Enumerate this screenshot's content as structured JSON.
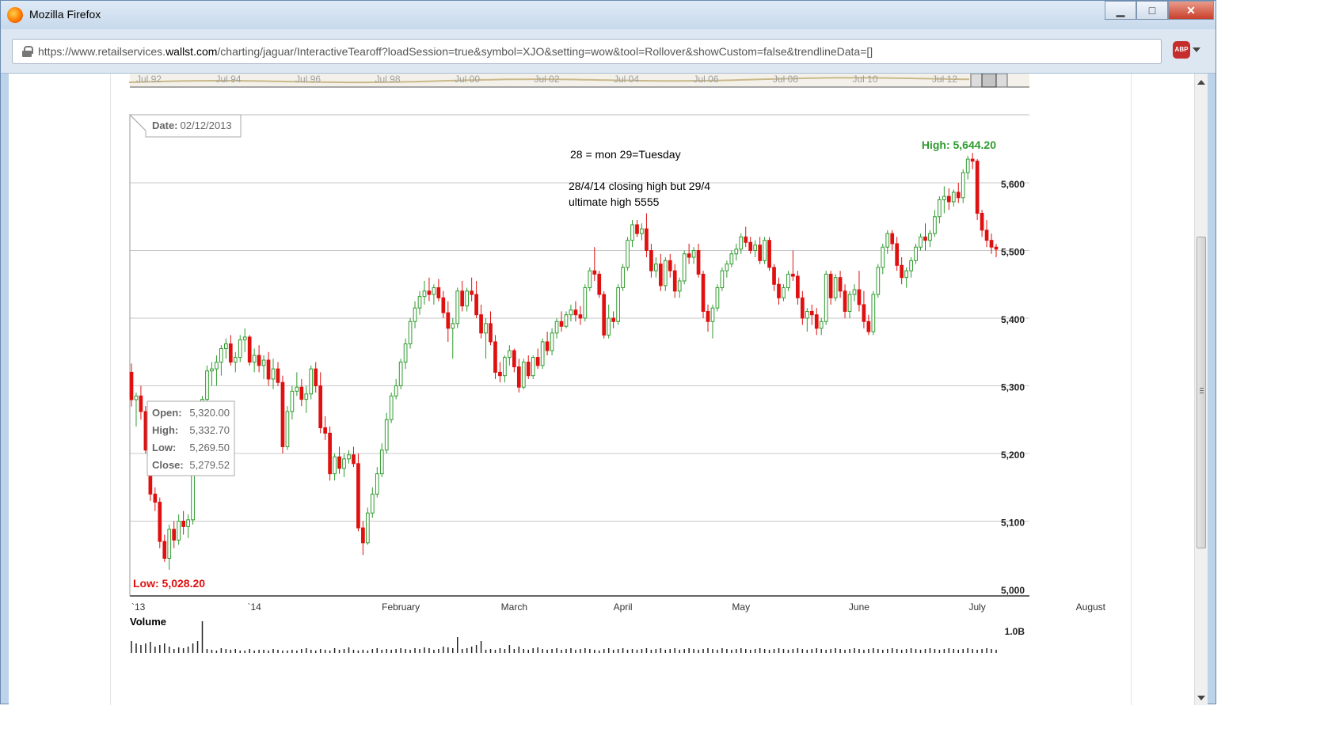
{
  "window": {
    "title": "Mozilla Firefox",
    "url_prefix": "https://www.retailservices.",
    "url_domain": "wallst.com",
    "url_suffix": "/charting/jaguar/InteractiveTearoff?loadSession=true&symbol=XJO&setting=wow&tool=Rollover&showCustom=false&trendlineData=[]",
    "minimize_label": "▁",
    "maximize_label": "□",
    "close_label": "✕",
    "adblock_label": "ABP"
  },
  "navigator": {
    "labels": [
      "Jul 92",
      "Jul 94",
      "Jul 96",
      "Jul 98",
      "Jul 00",
      "Jul 02",
      "Jul 04",
      "Jul 06",
      "Jul 08",
      "Jul 10",
      "Jul 12"
    ]
  },
  "chart": {
    "date_label": "Date:",
    "date_value": "02/12/2013",
    "annotation_line1": "28 = mon 29=Tuesday",
    "annotation_line2": "28/4/14 closing high but 29/4",
    "annotation_line3": "ultimate high 5555",
    "high_label": "High: 5,644.20",
    "low_label": "Low: 5,028.20",
    "tooltip": {
      "open_label": "Open:",
      "open_value": "5,320.00",
      "high_label": "High:",
      "high_value": "5,332.70",
      "low_label": "Low:",
      "low_value": "5,269.50",
      "close_label": "Close:",
      "close_value": "5,279.52"
    },
    "volume_label": "Volume",
    "volume_tick": "1.0B",
    "colors": {
      "up": "#2e9b2e",
      "down": "#e01010",
      "high": "#2e9b2e",
      "low": "#e01010",
      "grid": "#c8c8c8"
    }
  },
  "chart_data": {
    "type": "candlestick",
    "title": "",
    "ylim": [
      5000,
      5680
    ],
    "y_ticks": [
      "5,000",
      "5,100",
      "5,200",
      "5,300",
      "5,400",
      "5,500",
      "5,600"
    ],
    "y_tick_values": [
      5000,
      5100,
      5200,
      5300,
      5400,
      5500,
      5600
    ],
    "x_labels": [
      "`13",
      "`14",
      "February",
      "March",
      "April",
      "May",
      "June",
      "July",
      "August"
    ],
    "x_label_index": [
      0,
      26,
      57,
      81,
      104,
      129,
      154,
      179,
      203
    ],
    "candles": [
      [
        5320,
        5332.7,
        5269.5,
        5279.5
      ],
      [
        5279.5,
        5290,
        5240,
        5285
      ],
      [
        5285,
        5300,
        5250,
        5262
      ],
      [
        5262,
        5270,
        5200,
        5205
      ],
      [
        5205,
        5215,
        5130,
        5140
      ],
      [
        5140,
        5150,
        5115,
        5128
      ],
      [
        5128,
        5135,
        5060,
        5070
      ],
      [
        5070,
        5080,
        5040,
        5045
      ],
      [
        5045,
        5095,
        5028.2,
        5088
      ],
      [
        5088,
        5100,
        5060,
        5072
      ],
      [
        5072,
        5110,
        5065,
        5100
      ],
      [
        5100,
        5115,
        5080,
        5092
      ],
      [
        5092,
        5110,
        5075,
        5102
      ],
      [
        5102,
        5210,
        5095,
        5200
      ],
      [
        5200,
        5270,
        5190,
        5262
      ],
      [
        5262,
        5285,
        5250,
        5280
      ],
      [
        5280,
        5330,
        5275,
        5322
      ],
      [
        5322,
        5335,
        5300,
        5325
      ],
      [
        5325,
        5345,
        5300,
        5335
      ],
      [
        5335,
        5360,
        5315,
        5355
      ],
      [
        5355,
        5370,
        5340,
        5362
      ],
      [
        5362,
        5375,
        5330,
        5335
      ],
      [
        5335,
        5350,
        5320,
        5342
      ],
      [
        5342,
        5375,
        5335,
        5368
      ],
      [
        5368,
        5385,
        5350,
        5372
      ],
      [
        5372,
        5375,
        5330,
        5335
      ],
      [
        5335,
        5355,
        5320,
        5345
      ],
      [
        5345,
        5360,
        5320,
        5330
      ],
      [
        5330,
        5345,
        5310,
        5338
      ],
      [
        5338,
        5350,
        5300,
        5310
      ],
      [
        5310,
        5340,
        5295,
        5325
      ],
      [
        5325,
        5335,
        5300,
        5305
      ],
      [
        5305,
        5315,
        5200,
        5210
      ],
      [
        5210,
        5270,
        5205,
        5262
      ],
      [
        5262,
        5300,
        5250,
        5292
      ],
      [
        5292,
        5320,
        5285,
        5298
      ],
      [
        5298,
        5310,
        5270,
        5280
      ],
      [
        5280,
        5300,
        5260,
        5288
      ],
      [
        5288,
        5330,
        5280,
        5325
      ],
      [
        5325,
        5335,
        5290,
        5300
      ],
      [
        5300,
        5320,
        5230,
        5238
      ],
      [
        5238,
        5255,
        5220,
        5230
      ],
      [
        5230,
        5240,
        5160,
        5170
      ],
      [
        5170,
        5200,
        5160,
        5195
      ],
      [
        5195,
        5210,
        5170,
        5178
      ],
      [
        5178,
        5200,
        5165,
        5192
      ],
      [
        5192,
        5205,
        5185,
        5198
      ],
      [
        5198,
        5210,
        5180,
        5185
      ],
      [
        5185,
        5200,
        5085,
        5090
      ],
      [
        5090,
        5100,
        5050,
        5068
      ],
      [
        5068,
        5120,
        5065,
        5112
      ],
      [
        5112,
        5150,
        5105,
        5140
      ],
      [
        5140,
        5180,
        5135,
        5170
      ],
      [
        5170,
        5215,
        5165,
        5205
      ],
      [
        5205,
        5260,
        5200,
        5250
      ],
      [
        5250,
        5290,
        5245,
        5285
      ],
      [
        5285,
        5310,
        5280,
        5300
      ],
      [
        5300,
        5340,
        5295,
        5335
      ],
      [
        5335,
        5370,
        5325,
        5362
      ],
      [
        5362,
        5400,
        5355,
        5395
      ],
      [
        5395,
        5425,
        5385,
        5415
      ],
      [
        5415,
        5440,
        5405,
        5432
      ],
      [
        5432,
        5455,
        5420,
        5440
      ],
      [
        5440,
        5460,
        5425,
        5435
      ],
      [
        5435,
        5450,
        5420,
        5445
      ],
      [
        5445,
        5458,
        5425,
        5430
      ],
      [
        5430,
        5440,
        5400,
        5408
      ],
      [
        5408,
        5425,
        5365,
        5385
      ],
      [
        5385,
        5400,
        5340,
        5392
      ],
      [
        5392,
        5445,
        5385,
        5440
      ],
      [
        5440,
        5455,
        5410,
        5418
      ],
      [
        5418,
        5445,
        5410,
        5440
      ],
      [
        5440,
        5460,
        5425,
        5435
      ],
      [
        5435,
        5455,
        5400,
        5405
      ],
      [
        5405,
        5420,
        5370,
        5378
      ],
      [
        5378,
        5400,
        5340,
        5392
      ],
      [
        5392,
        5410,
        5360,
        5365
      ],
      [
        5365,
        5375,
        5310,
        5320
      ],
      [
        5320,
        5335,
        5305,
        5315
      ],
      [
        5315,
        5345,
        5305,
        5342
      ],
      [
        5342,
        5360,
        5330,
        5352
      ],
      [
        5352,
        5355,
        5320,
        5328
      ],
      [
        5328,
        5340,
        5290,
        5298
      ],
      [
        5298,
        5340,
        5295,
        5335
      ],
      [
        5335,
        5345,
        5310,
        5315
      ],
      [
        5315,
        5345,
        5310,
        5342
      ],
      [
        5342,
        5355,
        5325,
        5330
      ],
      [
        5330,
        5370,
        5325,
        5365
      ],
      [
        5365,
        5380,
        5345,
        5352
      ],
      [
        5352,
        5385,
        5345,
        5378
      ],
      [
        5378,
        5400,
        5370,
        5395
      ],
      [
        5395,
        5410,
        5380,
        5388
      ],
      [
        5388,
        5410,
        5385,
        5405
      ],
      [
        5405,
        5420,
        5395,
        5412
      ],
      [
        5412,
        5425,
        5395,
        5405
      ],
      [
        5405,
        5418,
        5390,
        5400
      ],
      [
        5400,
        5450,
        5395,
        5445
      ],
      [
        5445,
        5475,
        5440,
        5470
      ],
      [
        5470,
        5505,
        5455,
        5465
      ],
      [
        5465,
        5470,
        5430,
        5435
      ],
      [
        5435,
        5440,
        5370,
        5375
      ],
      [
        5375,
        5420,
        5370,
        5400
      ],
      [
        5400,
        5410,
        5385,
        5395
      ],
      [
        5395,
        5450,
        5390,
        5445
      ],
      [
        5445,
        5480,
        5440,
        5475
      ],
      [
        5475,
        5520,
        5470,
        5515
      ],
      [
        5515,
        5545,
        5505,
        5538
      ],
      [
        5538,
        5545,
        5520,
        5525
      ],
      [
        5525,
        5540,
        5515,
        5532
      ],
      [
        5532,
        5555,
        5490,
        5500
      ],
      [
        5500,
        5510,
        5460,
        5470
      ],
      [
        5470,
        5490,
        5460,
        5480
      ],
      [
        5480,
        5495,
        5440,
        5448
      ],
      [
        5448,
        5490,
        5440,
        5485
      ],
      [
        5485,
        5495,
        5460,
        5470
      ],
      [
        5470,
        5480,
        5430,
        5440
      ],
      [
        5440,
        5460,
        5430,
        5455
      ],
      [
        5455,
        5500,
        5450,
        5495
      ],
      [
        5495,
        5510,
        5480,
        5490
      ],
      [
        5490,
        5505,
        5480,
        5500
      ],
      [
        5500,
        5510,
        5460,
        5465
      ],
      [
        5465,
        5470,
        5400,
        5410
      ],
      [
        5410,
        5420,
        5380,
        5395
      ],
      [
        5395,
        5420,
        5370,
        5415
      ],
      [
        5415,
        5450,
        5410,
        5445
      ],
      [
        5445,
        5475,
        5440,
        5470
      ],
      [
        5470,
        5485,
        5460,
        5480
      ],
      [
        5480,
        5500,
        5475,
        5495
      ],
      [
        5495,
        5510,
        5485,
        5502
      ],
      [
        5502,
        5525,
        5495,
        5520
      ],
      [
        5520,
        5535,
        5505,
        5512
      ],
      [
        5512,
        5520,
        5495,
        5500
      ],
      [
        5500,
        5515,
        5490,
        5508
      ],
      [
        5508,
        5520,
        5480,
        5485
      ],
      [
        5485,
        5520,
        5480,
        5515
      ],
      [
        5515,
        5520,
        5470,
        5475
      ],
      [
        5475,
        5480,
        5440,
        5450
      ],
      [
        5450,
        5460,
        5420,
        5430
      ],
      [
        5430,
        5450,
        5425,
        5445
      ],
      [
        5445,
        5470,
        5440,
        5465
      ],
      [
        5465,
        5500,
        5455,
        5462
      ],
      [
        5462,
        5470,
        5420,
        5430
      ],
      [
        5430,
        5440,
        5390,
        5400
      ],
      [
        5400,
        5415,
        5380,
        5410
      ],
      [
        5410,
        5420,
        5390,
        5405
      ],
      [
        5405,
        5415,
        5375,
        5385
      ],
      [
        5385,
        5400,
        5375,
        5395
      ],
      [
        5395,
        5470,
        5390,
        5465
      ],
      [
        5465,
        5470,
        5420,
        5430
      ],
      [
        5430,
        5465,
        5425,
        5460
      ],
      [
        5460,
        5470,
        5430,
        5440
      ],
      [
        5440,
        5450,
        5400,
        5410
      ],
      [
        5410,
        5440,
        5400,
        5435
      ],
      [
        5435,
        5450,
        5425,
        5442
      ],
      [
        5442,
        5470,
        5410,
        5420
      ],
      [
        5420,
        5440,
        5385,
        5395
      ],
      [
        5395,
        5405,
        5375,
        5380
      ],
      [
        5380,
        5440,
        5375,
        5435
      ],
      [
        5435,
        5480,
        5430,
        5475
      ],
      [
        5475,
        5510,
        5465,
        5505
      ],
      [
        5505,
        5530,
        5495,
        5525
      ],
      [
        5525,
        5530,
        5500,
        5510
      ],
      [
        5510,
        5520,
        5470,
        5478
      ],
      [
        5478,
        5490,
        5450,
        5460
      ],
      [
        5460,
        5475,
        5445,
        5470
      ],
      [
        5470,
        5490,
        5460,
        5485
      ],
      [
        5485,
        5510,
        5480,
        5505
      ],
      [
        5505,
        5525,
        5500,
        5520
      ],
      [
        5520,
        5540,
        5500,
        5515
      ],
      [
        5515,
        5530,
        5505,
        5525
      ],
      [
        5525,
        5560,
        5520,
        5550
      ],
      [
        5550,
        5580,
        5540,
        5575
      ],
      [
        5575,
        5595,
        5555,
        5580
      ],
      [
        5580,
        5592,
        5560,
        5572
      ],
      [
        5572,
        5590,
        5565,
        5586
      ],
      [
        5586,
        5600,
        5570,
        5578
      ],
      [
        5578,
        5620,
        5570,
        5615
      ],
      [
        5615,
        5640,
        5605,
        5635
      ],
      [
        5635,
        5644.2,
        5620,
        5632
      ],
      [
        5632,
        5635,
        5545,
        5555
      ],
      [
        5555,
        5560,
        5520,
        5530
      ],
      [
        5530,
        5545,
        5505,
        5515
      ],
      [
        5515,
        5525,
        5495,
        5505
      ],
      [
        5505,
        5510,
        5490,
        5502
      ]
    ],
    "volume": [
      0.15,
      0.12,
      0.1,
      0.12,
      0.14,
      0.08,
      0.1,
      0.12,
      0.08,
      0.05,
      0.07,
      0.06,
      0.08,
      0.12,
      0.15,
      0.4,
      0.05,
      0.04,
      0.03,
      0.06,
      0.05,
      0.04,
      0.05,
      0.03,
      0.03,
      0.05,
      0.03,
      0.04,
      0.04,
      0.03,
      0.05,
      0.04,
      0.03,
      0.03,
      0.04,
      0.03,
      0.05,
      0.06,
      0.04,
      0.03,
      0.05,
      0.04,
      0.03,
      0.06,
      0.04,
      0.05,
      0.07,
      0.04,
      0.03,
      0.04,
      0.03,
      0.05,
      0.06,
      0.04,
      0.05,
      0.04,
      0.05,
      0.06,
      0.05,
      0.04,
      0.06,
      0.05,
      0.07,
      0.06,
      0.04,
      0.05,
      0.08,
      0.07,
      0.06,
      0.2,
      0.05,
      0.06,
      0.08,
      0.1,
      0.15,
      0.04,
      0.05,
      0.04,
      0.06,
      0.05,
      0.1,
      0.05,
      0.08,
      0.05,
      0.04,
      0.06,
      0.07,
      0.05,
      0.04,
      0.05,
      0.06,
      0.04,
      0.05,
      0.06,
      0.04,
      0.05,
      0.06,
      0.05,
      0.04,
      0.03,
      0.05,
      0.06,
      0.04,
      0.05,
      0.06,
      0.04,
      0.05,
      0.04,
      0.05,
      0.06,
      0.04,
      0.05,
      0.06,
      0.04,
      0.05,
      0.06,
      0.04,
      0.05,
      0.06,
      0.05,
      0.04,
      0.05,
      0.06,
      0.05,
      0.04,
      0.06,
      0.05,
      0.04,
      0.05,
      0.06,
      0.05,
      0.04,
      0.05,
      0.06,
      0.05,
      0.04,
      0.05,
      0.06,
      0.05,
      0.04,
      0.05,
      0.06,
      0.05,
      0.04,
      0.05,
      0.06,
      0.05,
      0.04,
      0.05,
      0.06,
      0.05,
      0.04,
      0.05,
      0.06,
      0.05,
      0.04,
      0.05,
      0.06,
      0.05,
      0.04,
      0.05,
      0.06,
      0.05,
      0.04,
      0.05,
      0.06,
      0.05,
      0.04,
      0.05,
      0.06,
      0.05,
      0.04,
      0.05,
      0.06,
      0.05,
      0.04,
      0.05,
      0.06,
      0.05,
      0.04,
      0.05,
      0.06,
      0.05,
      0.04,
      0.05,
      0.06,
      0.05,
      0.04,
      0.05,
      0.06,
      0.05,
      0.04,
      0.05,
      0.06,
      0.05,
      0.04,
      0.05,
      0.06,
      0.05,
      0.04,
      0.05,
      0.06,
      0.05,
      0.04,
      0.05,
      0.06,
      0.05,
      0.04
    ]
  }
}
